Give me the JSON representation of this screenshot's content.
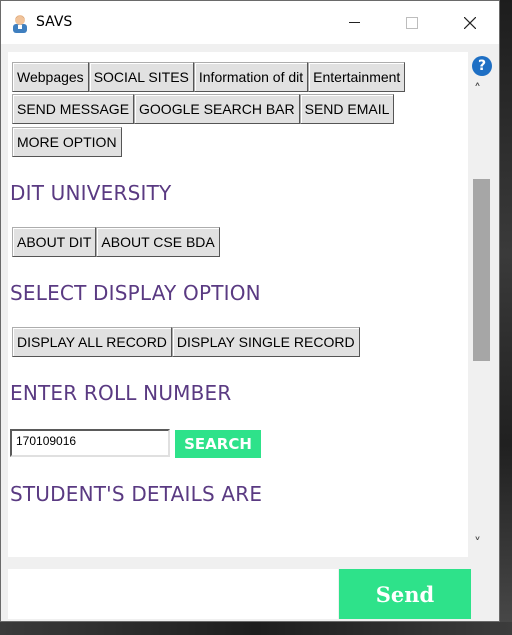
{
  "window": {
    "title": "SAVS",
    "app_icon": "user-avatar-icon"
  },
  "top_buttons": {
    "row1": [
      "Webpages",
      "SOCIAL SITES",
      "Information of dit",
      "Entertainment"
    ],
    "row2": [
      "SEND MESSAGE",
      "GOOGLE SEARCH BAR",
      "SEND EMAIL"
    ],
    "row3": [
      "MORE OPTION"
    ]
  },
  "sections": {
    "university": {
      "heading": "DIT UNIVERSITY",
      "buttons": [
        "ABOUT DIT",
        "ABOUT CSE BDA"
      ]
    },
    "display": {
      "heading": "SELECT DISPLAY OPTION",
      "buttons": [
        "DISPLAY ALL RECORD",
        "DISPLAY SINGLE RECORD"
      ]
    },
    "roll": {
      "heading": "ENTER ROLL NUMBER",
      "value": "170109016",
      "search_label": "SEARCH"
    },
    "details": {
      "heading": "STUDENT'S DETAILS ARE"
    }
  },
  "scrollbar": {
    "help_glyph": "?",
    "up_glyph": "˄",
    "down_glyph": "˅"
  },
  "footer": {
    "message_value": "",
    "send_label": "Send"
  },
  "colors": {
    "heading": "#5a3a82",
    "accent_green": "#2ee28a",
    "help_blue": "#1e6fc4"
  }
}
